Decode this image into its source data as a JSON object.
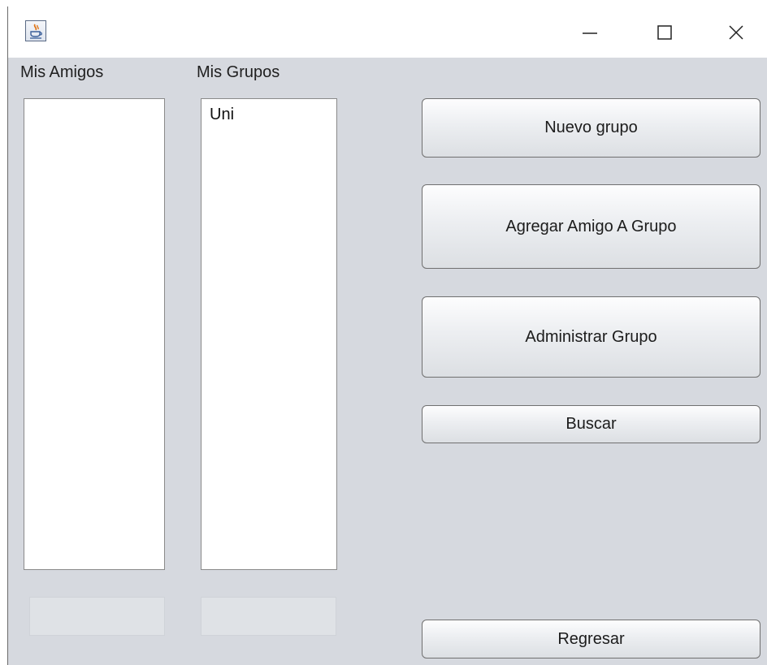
{
  "window": {
    "title": "",
    "controls": {
      "minimize_icon": "minimize-icon",
      "maximize_icon": "maximize-icon",
      "close_icon": "close-icon"
    }
  },
  "labels": {
    "friends": "Mis Amigos",
    "groups": "Mis Grupos"
  },
  "friends_list": {
    "items": []
  },
  "groups_list": {
    "items": [
      "Uni"
    ]
  },
  "buttons": {
    "new_group": "Nuevo grupo",
    "add_friend_to_group": "Agregar Amigo A Grupo",
    "manage_group": "Administrar Grupo",
    "search": "Buscar",
    "back": "Regresar"
  },
  "fields": {
    "friend_field_value": "",
    "group_field_value": ""
  },
  "colors": {
    "window_background": "#d6d9df",
    "titlebar": "#ffffff",
    "list_background": "#ffffff"
  }
}
